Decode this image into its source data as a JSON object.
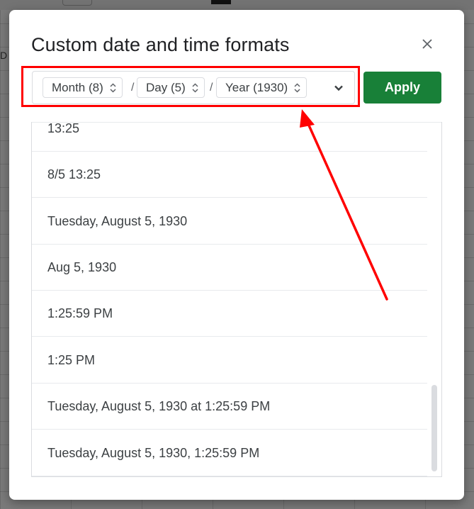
{
  "dialog": {
    "title": "Custom date and time formats",
    "close_icon": "close-icon",
    "apply_label": "Apply",
    "apply_color": "#188038"
  },
  "format_bar": {
    "chips": [
      {
        "label": "Month (8)"
      },
      {
        "label": "Day (5)"
      },
      {
        "label": "Year (1930)"
      }
    ],
    "separators": [
      "/",
      "/"
    ],
    "dropdown_icon": "chevron-down-icon"
  },
  "formats": [
    {
      "label": "13:25"
    },
    {
      "label": "8/5 13:25"
    },
    {
      "label": "Tuesday, August 5, 1930"
    },
    {
      "label": "Aug 5, 1930"
    },
    {
      "label": "1:25:59 PM"
    },
    {
      "label": "1:25 PM"
    },
    {
      "label": "Tuesday, August 5, 1930 at 1:25:59 PM"
    },
    {
      "label": "Tuesday, August 5, 1930, 1:25:59 PM"
    }
  ],
  "background": {
    "edge_glyph": "D"
  },
  "annotation": {
    "color": "#ff0000"
  }
}
